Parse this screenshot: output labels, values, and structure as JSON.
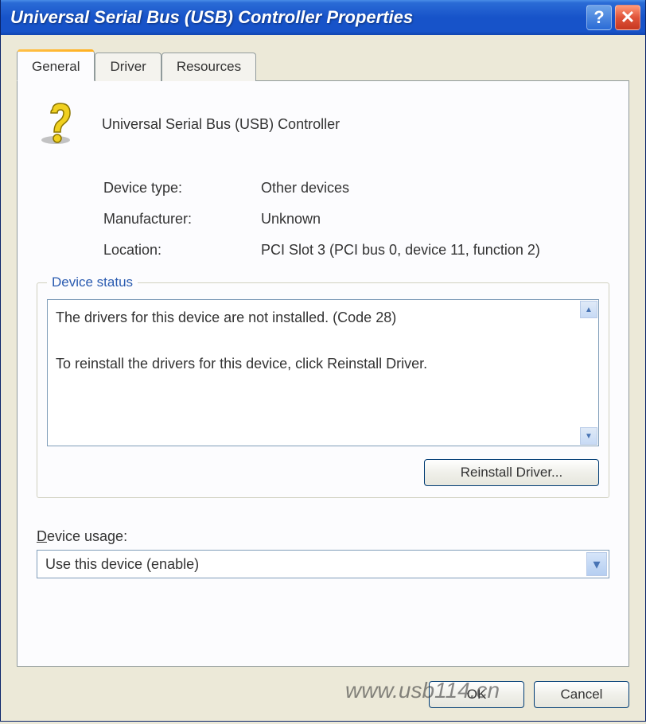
{
  "window": {
    "title": "Universal Serial Bus (USB) Controller Properties"
  },
  "tabs": {
    "general": "General",
    "driver": "Driver",
    "resources": "Resources"
  },
  "device": {
    "name": "Universal Serial Bus (USB) Controller",
    "type_label": "Device type:",
    "type_value": "Other devices",
    "manufacturer_label": "Manufacturer:",
    "manufacturer_value": "Unknown",
    "location_label": "Location:",
    "location_value": "PCI Slot 3 (PCI bus 0, device 11, function 2)"
  },
  "status": {
    "group_title": "Device status",
    "text": "The drivers for this device are not installed. (Code 28)\n\nTo reinstall the drivers for this device, click Reinstall Driver.",
    "reinstall_button": "Reinstall Driver..."
  },
  "usage": {
    "label_prefix": "D",
    "label_rest": "evice usage:",
    "selected": "Use this device (enable)"
  },
  "buttons": {
    "ok": "OK",
    "cancel": "Cancel"
  },
  "watermark": "www.usb114.cn"
}
